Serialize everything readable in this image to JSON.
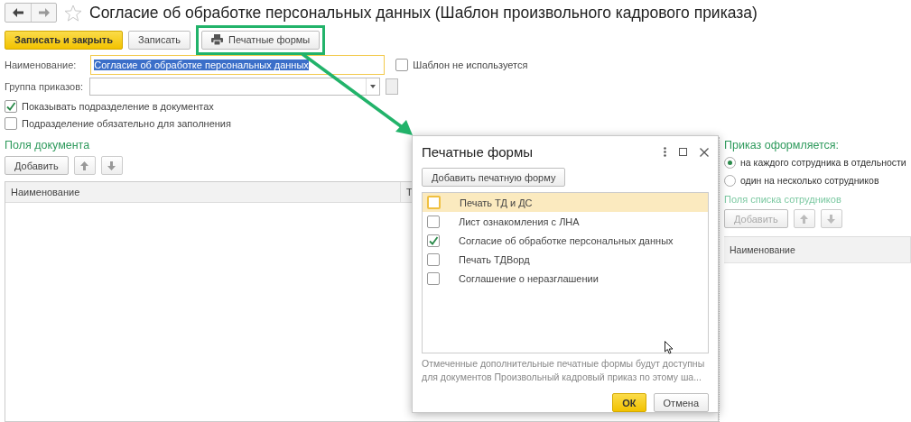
{
  "window": {
    "title": "Согласие об обработке персональных данных (Шаблон произвольного кадрового приказа)"
  },
  "toolbar": [
    {
      "label": "Записать и закрыть",
      "kind": "primary",
      "highlighted": false
    },
    {
      "label": "Записать",
      "kind": "plain",
      "highlighted": false
    },
    {
      "label": "Печатные формы",
      "kind": "print",
      "highlighted": true
    }
  ],
  "name_field": {
    "label": "Наименование:",
    "value": "Согласие об обработке персональных данных",
    "text_selected": true
  },
  "unused_checkbox": {
    "label": "Шаблон не используется",
    "checked": false
  },
  "group_field": {
    "label": "Группа приказов:"
  },
  "options": [
    {
      "label": "Показывать подразделение в документах",
      "checked": true
    },
    {
      "label": "Подразделение обязательно для заполнения",
      "checked": false
    }
  ],
  "document_fields": {
    "title": "Поля документа",
    "add_label": "Добавить",
    "disabled": false,
    "columns": [
      "Наименование",
      "Т"
    ]
  },
  "order_mode": {
    "title": "Приказ оформляется:",
    "options": [
      {
        "label": "на каждого сотрудника в отдельности",
        "selected": true
      },
      {
        "label": "один на несколько сотрудников",
        "selected": false
      }
    ]
  },
  "employee_fields": {
    "title": "Поля списка сотрудников",
    "add_label": "Добавить",
    "disabled": true,
    "columns": [
      "Наименование"
    ]
  },
  "dialog": {
    "title": "Печатные формы",
    "add_button": "Добавить печатную форму",
    "items": [
      {
        "label": "Печать ТД и ДС",
        "checked": false,
        "selected": true
      },
      {
        "label": "Лист ознакомления с ЛНА",
        "checked": false,
        "selected": false
      },
      {
        "label": "Согласие об обработке персональных данных",
        "checked": true,
        "selected": false
      },
      {
        "label": "Печать ТДВорд",
        "checked": false,
        "selected": false
      },
      {
        "label": "Соглашение о неразглашении",
        "checked": false,
        "selected": false
      }
    ],
    "note": "Отмеченные дополнительные печатные формы будут доступны для документов Произвольный кадровый приказ по этому ша...",
    "buttons": [
      {
        "label": "ОК",
        "kind": "primary"
      },
      {
        "label": "Отмена",
        "kind": "plain"
      }
    ]
  }
}
